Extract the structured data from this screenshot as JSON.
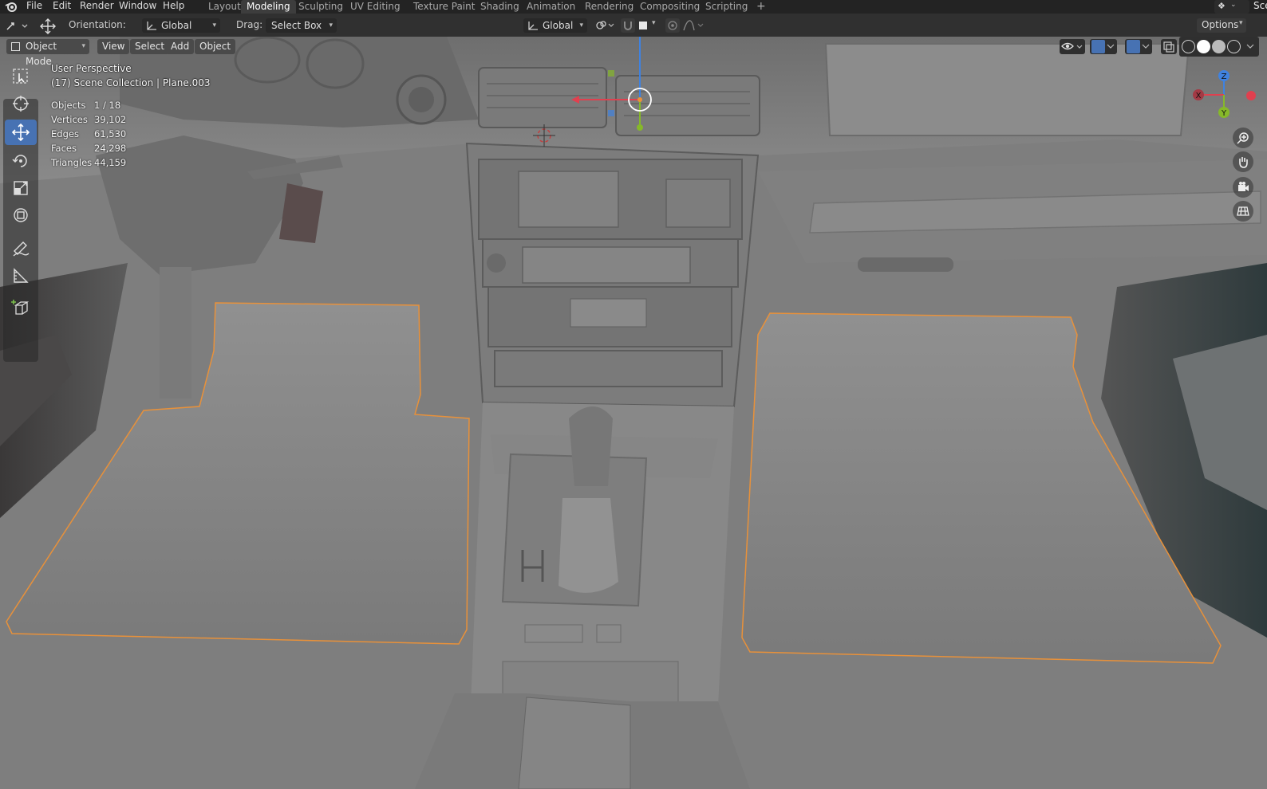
{
  "topbar": {
    "menus": [
      "File",
      "Edit",
      "Render",
      "Window",
      "Help"
    ],
    "workspace_tabs": [
      "Layout",
      "Modeling",
      "Sculpting",
      "UV Editing",
      "Texture Paint",
      "Shading",
      "Animation",
      "Rendering",
      "Compositing",
      "Scripting"
    ],
    "active_tab": "Modeling",
    "add_tab": "+",
    "scene_label": "Scene"
  },
  "tool_header": {
    "orientation_label": "Orientation:",
    "orientation_value": "Global",
    "drag_label": "Drag:",
    "drag_value": "Select Box",
    "transform_orientation": "Global",
    "options_label": "Options"
  },
  "viewport_header": {
    "mode": "Object Mode",
    "menus": [
      "View",
      "Select",
      "Add",
      "Object"
    ]
  },
  "overlay": {
    "view_name": "User Perspective",
    "collection_info": "(17) Scene Collection | Plane.003",
    "stats": [
      {
        "label": "Objects",
        "value": "1 / 18"
      },
      {
        "label": "Vertices",
        "value": "39,102"
      },
      {
        "label": "Edges",
        "value": "61,530"
      },
      {
        "label": "Faces",
        "value": "24,298"
      },
      {
        "label": "Triangles",
        "value": "44,159"
      }
    ]
  },
  "gizmo": {
    "x_label": "X",
    "y_label": "Y",
    "z_label": "Z"
  },
  "toolbar_tools": [
    "select-box-icon",
    "cursor-icon",
    "move-icon",
    "rotate-icon",
    "scale-icon",
    "transform-icon",
    "annotate-icon",
    "measure-icon",
    "add-cube-icon"
  ],
  "active_tool": "move-icon",
  "colors": {
    "accent": "#4772b3",
    "selection_outline": "#e8913a",
    "axis_x": "#e0404f",
    "axis_y": "#86b82a",
    "axis_z": "#3f82e0"
  }
}
